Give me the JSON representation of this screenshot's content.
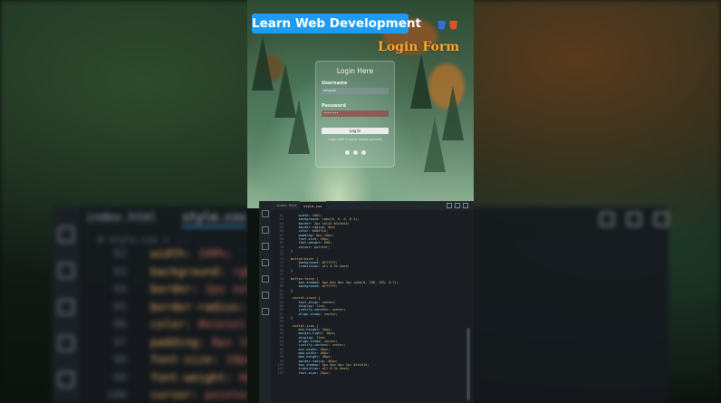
{
  "header": {
    "badge": "Learn Web Development",
    "subtitle": "Login Form",
    "tech_icons": [
      "css3-icon",
      "html5-icon"
    ]
  },
  "login_card": {
    "title": "Login Here",
    "username_label": "Username",
    "username_value": "rehanali",
    "password_label": "Password",
    "password_value": "••••••••",
    "button_label": "Log In",
    "note": "Login with a social media account",
    "social_icons": [
      "github-icon",
      "twitter-icon",
      "instagram-icon"
    ]
  },
  "editor": {
    "tabs": [
      {
        "label": "index.html",
        "active": false
      },
      {
        "label": "style.css",
        "active": true
      }
    ],
    "breadcrumb": "# style.css > ...",
    "lines": [
      {
        "n": "62",
        "t": "    width: 100%;"
      },
      {
        "n": "63",
        "t": "    background: rgba(0, 0, 0, 0.1);"
      },
      {
        "n": "64",
        "t": "    border: 2px solid #1e1e1e;"
      },
      {
        "n": "65",
        "t": "    border-radius: 5px;"
      },
      {
        "n": "66",
        "t": "    color: #080710;"
      },
      {
        "n": "67",
        "t": "    padding: 8px 15px;"
      },
      {
        "n": "68",
        "t": "    font-size: 18px;"
      },
      {
        "n": "69",
        "t": "    font-weight: 600;"
      },
      {
        "n": "70",
        "t": "    cursor: pointer;"
      },
      {
        "n": "71",
        "t": "}"
      },
      {
        "n": "72",
        "t": ""
      },
      {
        "n": "73",
        "t": "button:hover {"
      },
      {
        "n": "74",
        "t": "    background: #ffffff;"
      },
      {
        "n": "75",
        "t": "    transition: all 0.3s ease;"
      },
      {
        "n": "76",
        "t": "}"
      },
      {
        "n": "77",
        "t": ""
      },
      {
        "n": "78",
        "t": "button:focus {"
      },
      {
        "n": "79",
        "t": "    box-shadow: 0px 0px 0px 3px rgba(0, 166, 255, 0.7);"
      },
      {
        "n": "80",
        "t": "    background: #ffffff;"
      },
      {
        "n": "81",
        "t": "}"
      },
      {
        "n": "82",
        "t": ""
      },
      {
        "n": "83",
        "t": ".social-icons {"
      },
      {
        "n": "84",
        "t": "    text-align: center;"
      },
      {
        "n": "85",
        "t": "    display: flex;"
      },
      {
        "n": "86",
        "t": "    justify-content: center;"
      },
      {
        "n": "87",
        "t": "    align-items: center;"
      },
      {
        "n": "88",
        "t": "}"
      },
      {
        "n": "89",
        "t": ""
      },
      {
        "n": "90",
        "t": ".social-icon {"
      },
      {
        "n": "91",
        "t": "    min-height: 40px;"
      },
      {
        "n": "92",
        "t": "    margin-right: 10px;"
      },
      {
        "n": "93",
        "t": "    display: flex;"
      },
      {
        "n": "94",
        "t": "    align-items: center;"
      },
      {
        "n": "95",
        "t": "    justify-content: center;"
      },
      {
        "n": "96",
        "t": "    min-width: 40px;"
      },
      {
        "n": "97",
        "t": "    max-width: 40px;"
      },
      {
        "n": "98",
        "t": "    max-height: 40px;"
      },
      {
        "n": "99",
        "t": "    border-radius: 40px;"
      },
      {
        "n": "100",
        "t": "    box-shadow: 0px 0px 0px 3px #1e1e1e;"
      },
      {
        "n": "101",
        "t": "    transition: all 0.3s ease;"
      },
      {
        "n": "102",
        "t": "    font-size: 20px;"
      }
    ]
  },
  "backdrop": {
    "tabs": [
      "index.html",
      "style.css"
    ],
    "breadcrumb": "# style.css > ...",
    "lines": [
      {
        "n": "92",
        "p": "width:",
        "v": " 100%;"
      },
      {
        "n": "93",
        "p": "background:",
        "v": " rgba"
      },
      {
        "n": "94",
        "p": "border:",
        "v": " 2px soli"
      },
      {
        "n": "95",
        "p": "border-radius:",
        "v": " 5"
      },
      {
        "n": "96",
        "p": "color:",
        "v": " #e1e1e1"
      },
      {
        "n": "97",
        "p": "padding:",
        "v": " 8px 15p"
      },
      {
        "n": "98",
        "p": "font-size:",
        "v": " 18px"
      },
      {
        "n": "99",
        "p": "font-weight:",
        "v": " 600"
      },
      {
        "n": "100",
        "p": "cursor:",
        "v": " pointer"
      },
      {
        "n": "101",
        "p": "}",
        "v": ""
      }
    ]
  },
  "colors": {
    "badge_bg": "#1e9bf0",
    "login_form_label": "#f3a93a",
    "editor_bg": "#1a1e23"
  }
}
